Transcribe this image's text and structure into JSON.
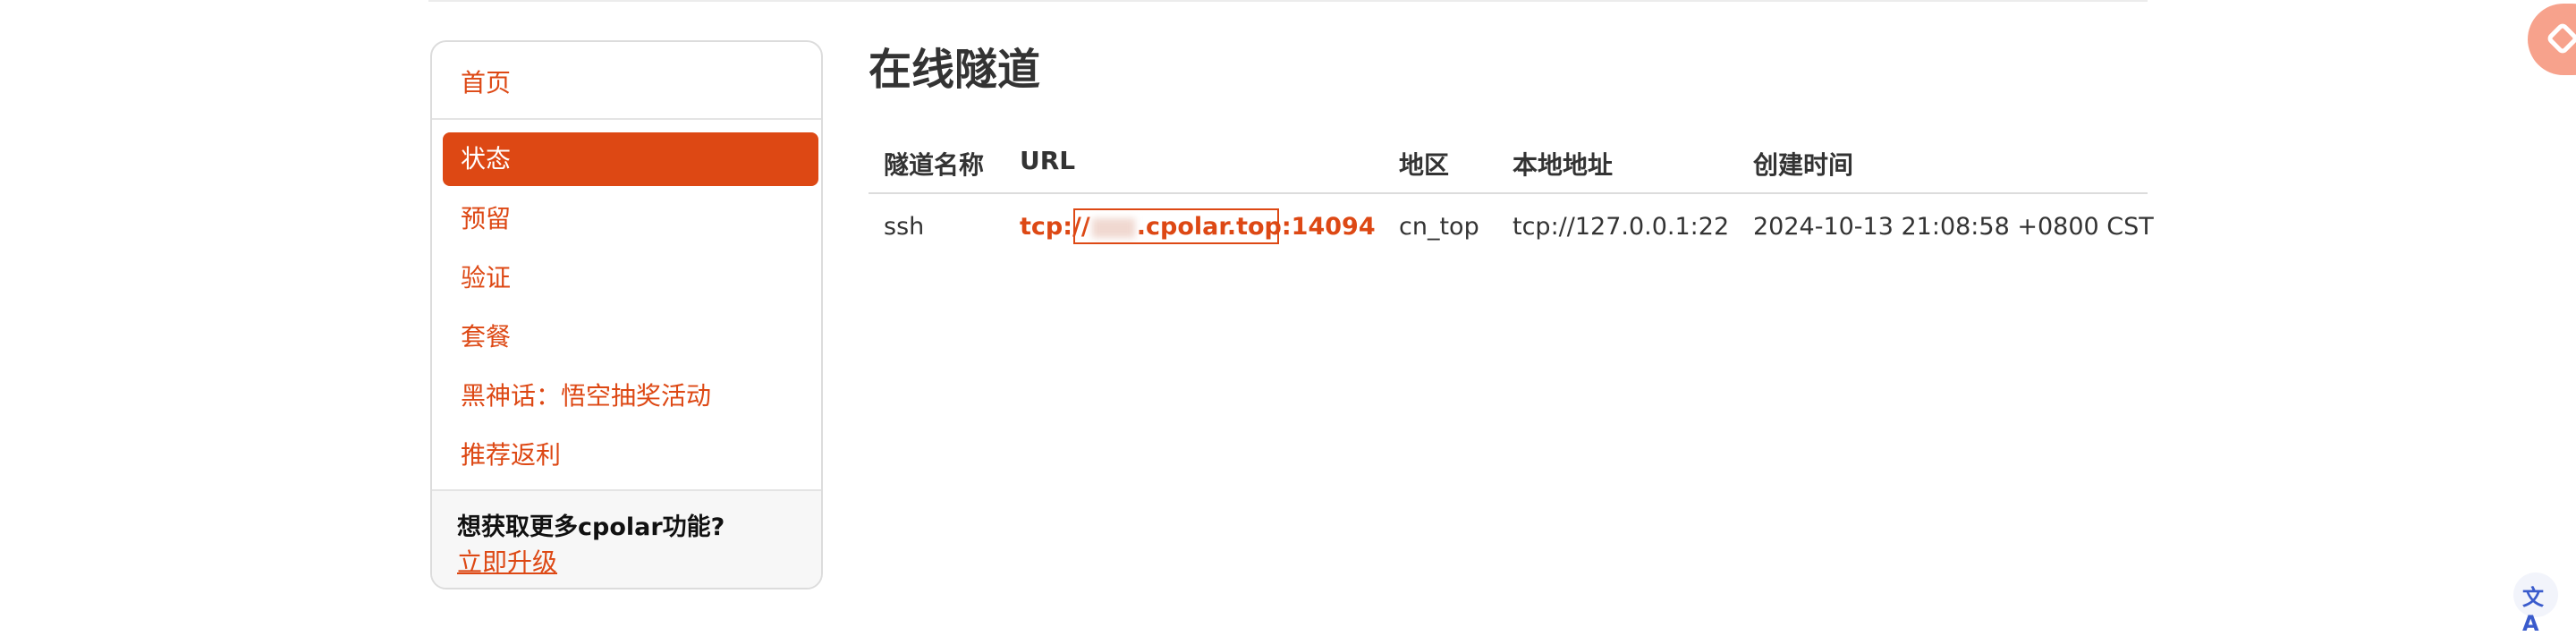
{
  "sidebar": {
    "home": "首页",
    "items": [
      {
        "label": "状态",
        "active": true
      },
      {
        "label": "预留",
        "active": false
      },
      {
        "label": "验证",
        "active": false
      },
      {
        "label": "套餐",
        "active": false
      },
      {
        "label": "黑神话：悟空抽奖活动",
        "active": false
      },
      {
        "label": "推荐返利",
        "active": false
      }
    ],
    "promo_title": "想获取更多cpolar功能?",
    "promo_link": "立即升级"
  },
  "main": {
    "title": "在线隧道",
    "columns": [
      "隧道名称",
      "URL",
      "地区",
      "本地地址",
      "创建时间"
    ],
    "rows": [
      {
        "name": "ssh",
        "url_prefix": "tcp://",
        "url_suffix": ".cpolar.top:14094",
        "region": "cn_top",
        "local": "tcp://127.0.0.1:22",
        "created": "2024-10-13 21:08:58 +0800 CST"
      }
    ]
  },
  "colors": {
    "accent": "#dd4814",
    "text": "#333333"
  },
  "icons": {
    "floating": "plugin-icon",
    "translate": "translate-icon"
  },
  "translate_glyph": "文A"
}
